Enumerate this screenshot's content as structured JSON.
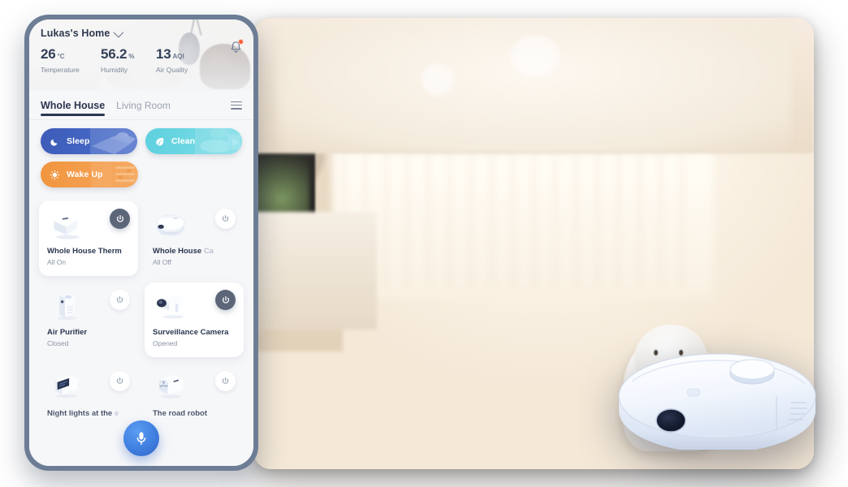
{
  "app": {
    "home_name": "Lukas's Home",
    "chevron_icon": "chevron-down-icon",
    "bell_icon": "notification-bell-icon"
  },
  "stats": [
    {
      "value": "26",
      "unit": "°C",
      "label": "Temperature"
    },
    {
      "value": "56.2",
      "unit": "%",
      "label": "Humidity"
    },
    {
      "value": "13",
      "unit": "AQI",
      "label": "Air Quality"
    }
  ],
  "tabs": [
    {
      "label": "Whole House",
      "active": true
    },
    {
      "label": "Living Room",
      "active": false
    }
  ],
  "menu_icon": "hamburger-menu-icon",
  "scenes": [
    {
      "label": "Sleep",
      "icon": "moon-icon",
      "color": "#3d5cb8"
    },
    {
      "label": "Clean",
      "icon": "leaf-icon",
      "color": "#5ed0de"
    },
    {
      "label": "Wake Up",
      "icon": "sun-icon",
      "color": "#f0953f"
    }
  ],
  "devices": [
    {
      "name": "Whole House Therm",
      "name_tail": "",
      "state": "All On",
      "on": true,
      "icon": "thermostat-icon"
    },
    {
      "name": "Whole House ",
      "name_tail": "Ca",
      "state": "All Off",
      "on": false,
      "icon": "robot-vacuum-icon"
    },
    {
      "name": "Air Purifier",
      "name_tail": "",
      "state": "Closed",
      "on": false,
      "icon": "air-purifier-icon"
    },
    {
      "name": "Surveillance Camera",
      "name_tail": "",
      "state": "Opened",
      "on": true,
      "icon": "security-camera-icon"
    },
    {
      "name": "Night lights at the ",
      "name_tail": "e",
      "state": "",
      "on": false,
      "icon": "night-light-icon"
    },
    {
      "name": "The road robot",
      "name_tail": "",
      "state": "",
      "on": false,
      "icon": "air-conditioner-icon"
    }
  ],
  "mic": {
    "icon": "microphone-icon",
    "label": "Voice assistant"
  },
  "photo": {
    "description": "Family with baby playing on living room floor",
    "overlay_product": "robot-vacuum"
  },
  "colors": {
    "bezel": "#6d7d96",
    "screen_bg": "#f6f7f9",
    "accent_dark": "#2b3650",
    "power_on": "#5c6678",
    "mic_blue": "#3f7fe0",
    "badge": "#f4623a"
  }
}
